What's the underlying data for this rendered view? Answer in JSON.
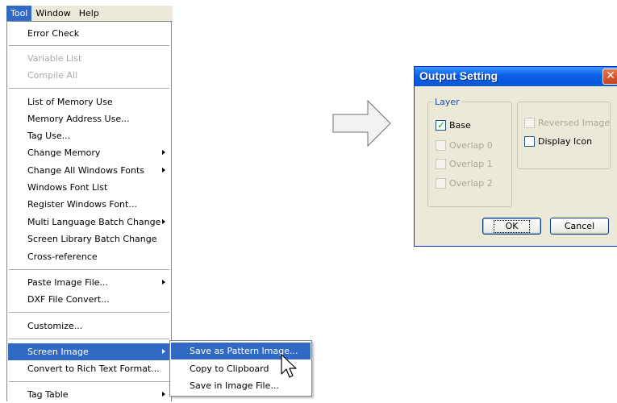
{
  "menubar": {
    "items": [
      "Tool",
      "Window",
      "Help"
    ]
  },
  "tool_menu": {
    "items": [
      {
        "label": "Error Check",
        "disabled": false
      },
      {
        "label": "Variable List",
        "disabled": true
      },
      {
        "label": "Compile All",
        "disabled": true
      },
      {
        "label": "List of Memory Use",
        "disabled": false
      },
      {
        "label": "Memory Address Use...",
        "disabled": false
      },
      {
        "label": "Tag Use...",
        "disabled": false
      },
      {
        "label": "Change Memory",
        "disabled": false,
        "submenu": true
      },
      {
        "label": "Change All Windows Fonts",
        "disabled": false,
        "submenu": true
      },
      {
        "label": "Windows Font List",
        "disabled": false
      },
      {
        "label": "Register Windows Font...",
        "disabled": false
      },
      {
        "label": "Multi Language Batch Change",
        "disabled": false,
        "submenu": true
      },
      {
        "label": "Screen Library Batch Change",
        "disabled": false
      },
      {
        "label": "Cross-reference",
        "disabled": false
      },
      {
        "label": "Paste Image File...",
        "disabled": false,
        "submenu": true
      },
      {
        "label": "DXF File Convert...",
        "disabled": false
      },
      {
        "label": "Customize...",
        "disabled": false
      },
      {
        "label": "Screen Image",
        "disabled": false,
        "submenu": true,
        "highlighted": true
      },
      {
        "label": "Convert to Rich Text Format...",
        "disabled": false
      },
      {
        "label": "Tag Table",
        "disabled": false,
        "submenu": true
      }
    ]
  },
  "screen_image_submenu": {
    "items": [
      {
        "label": "Save as Pattern Image...",
        "highlighted": true
      },
      {
        "label": "Copy to Clipboard",
        "highlighted": false
      },
      {
        "label": "Save in Image File...",
        "highlighted": false
      }
    ]
  },
  "dialog": {
    "title": "Output Setting",
    "layer_group_label": "Layer",
    "checkboxes": [
      {
        "label": "Base",
        "checked": true,
        "disabled": false
      },
      {
        "label": "Overlap 0",
        "checked": false,
        "disabled": true
      },
      {
        "label": "Overlap 1",
        "checked": false,
        "disabled": true
      },
      {
        "label": "Overlap 2",
        "checked": false,
        "disabled": true
      },
      {
        "label": "Reversed Image",
        "checked": false,
        "disabled": true
      },
      {
        "label": "Display Icon",
        "checked": false,
        "disabled": false
      }
    ],
    "ok_label": "OK",
    "cancel_label": "Cancel"
  },
  "colors": {
    "highlight": "#316ac5",
    "titlebar": "#0a5fe8",
    "dialog_bg": "#ece9d8"
  }
}
